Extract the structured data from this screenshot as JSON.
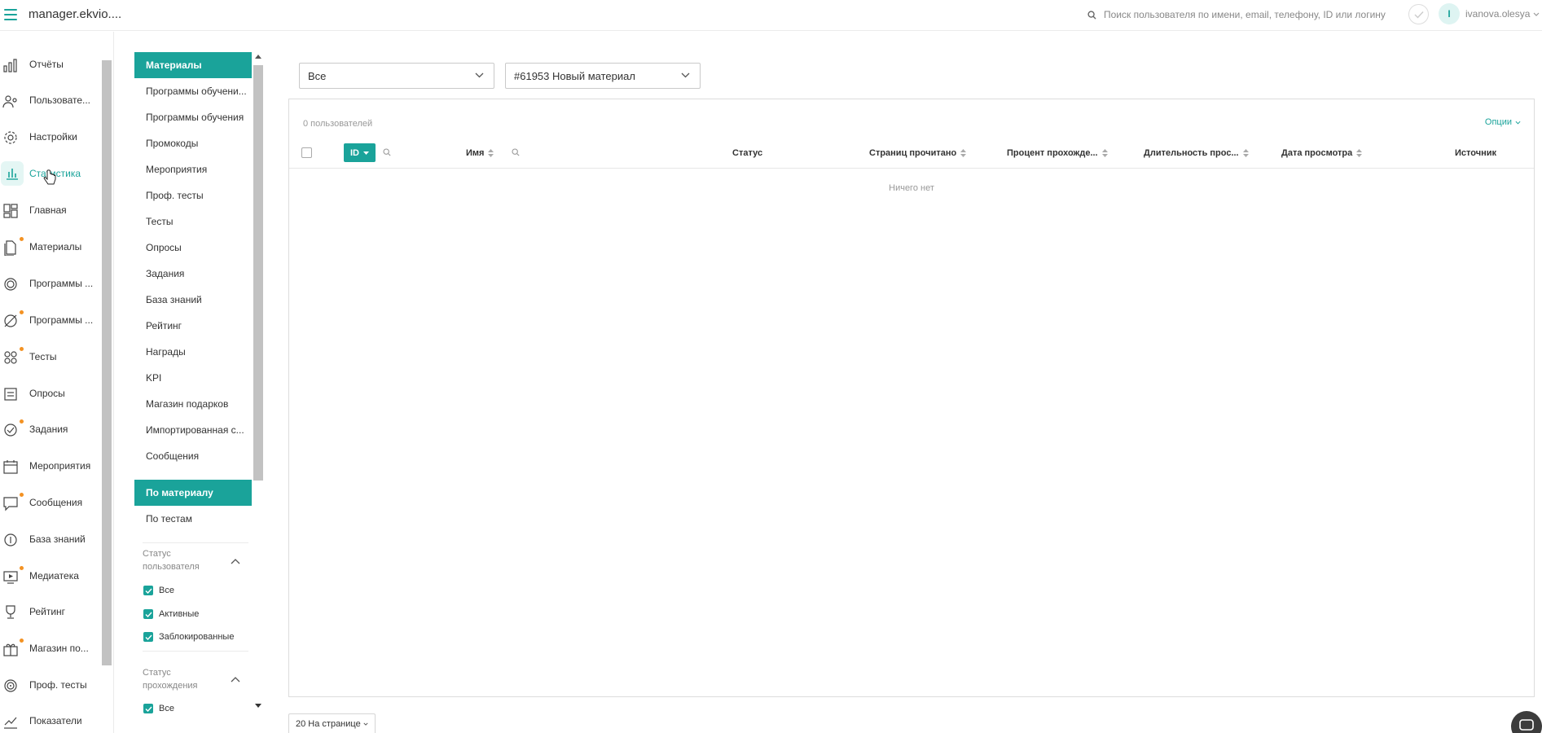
{
  "topbar": {
    "app_title": "manager.ekvio....",
    "search_placeholder": "Поиск пользователя по имени, email, телефону, ID или логину",
    "avatar_letter": "I",
    "username": "ivanova.olesya"
  },
  "sidebar": {
    "items": [
      {
        "label": "Отчёты",
        "icon": "reports-icon",
        "dot": false
      },
      {
        "label": "Пользовате...",
        "icon": "users-icon",
        "dot": false
      },
      {
        "label": "Настройки",
        "icon": "gear-icon",
        "dot": false
      },
      {
        "label": "Статистика",
        "icon": "stats-icon",
        "dot": false,
        "active": true
      },
      {
        "label": "Главная",
        "icon": "dashboard-icon",
        "dot": false
      },
      {
        "label": "Материалы",
        "icon": "materials-icon",
        "dot": true
      },
      {
        "label": "Программы ...",
        "icon": "programs-icon",
        "dot": false
      },
      {
        "label": "Программы ...",
        "icon": "route-icon",
        "dot": true
      },
      {
        "label": "Тесты",
        "icon": "tests-icon",
        "dot": true
      },
      {
        "label": "Опросы",
        "icon": "surveys-icon",
        "dot": false
      },
      {
        "label": "Задания",
        "icon": "tasks-icon",
        "dot": true
      },
      {
        "label": "Мероприятия",
        "icon": "calendar-icon",
        "dot": false
      },
      {
        "label": "Сообщения",
        "icon": "messages-icon",
        "dot": true
      },
      {
        "label": "База знаний",
        "icon": "knowledge-icon",
        "dot": false
      },
      {
        "label": "Медиатека",
        "icon": "media-icon",
        "dot": true
      },
      {
        "label": "Рейтинг",
        "icon": "trophy-icon",
        "dot": false
      },
      {
        "label": "Магазин по...",
        "icon": "gift-icon",
        "dot": true
      },
      {
        "label": "Проф. тесты",
        "icon": "proftests-icon",
        "dot": false
      },
      {
        "label": "Показатели",
        "icon": "metrics-icon",
        "dot": false
      }
    ]
  },
  "subnav": {
    "groups": [
      {
        "label": "Материалы",
        "active": true
      },
      {
        "label": "Программы обучени..."
      },
      {
        "label": "Программы обучения"
      },
      {
        "label": "Промокоды"
      },
      {
        "label": "Мероприятия"
      },
      {
        "label": "Проф. тесты"
      },
      {
        "label": "Тесты"
      },
      {
        "label": "Опросы"
      },
      {
        "label": "Задания"
      },
      {
        "label": "База знаний"
      },
      {
        "label": "Рейтинг"
      },
      {
        "label": "Награды"
      },
      {
        "label": "KPI"
      },
      {
        "label": "Магазин подарков"
      },
      {
        "label": "Импортированная с..."
      },
      {
        "label": "Сообщения"
      }
    ],
    "modes": [
      {
        "label": "По материалу",
        "active": true
      },
      {
        "label": "По тестам"
      }
    ],
    "user_status": {
      "title": "Статус пользователя",
      "options": [
        "Все",
        "Активные",
        "Заблокированные"
      ]
    },
    "pass_status": {
      "title": "Статус прохождения",
      "options": [
        "Все"
      ]
    }
  },
  "filters": {
    "group_select": "Все",
    "material_select": "#61953 Новый материал"
  },
  "table": {
    "count_label": "0 пользователей",
    "options_label": "Опции",
    "columns": {
      "id": "ID",
      "name": "Имя",
      "status": "Статус",
      "pages": "Страниц прочитано",
      "percent": "Процент прохожде...",
      "duration": "Длительность прос...",
      "date": "Дата просмотра",
      "source": "Источник"
    },
    "empty_text": "Ничего нет"
  },
  "pagination": {
    "per_page": "20 На странице"
  },
  "colors": {
    "accent": "#1aa39a",
    "badge_dot": "#f39223"
  }
}
